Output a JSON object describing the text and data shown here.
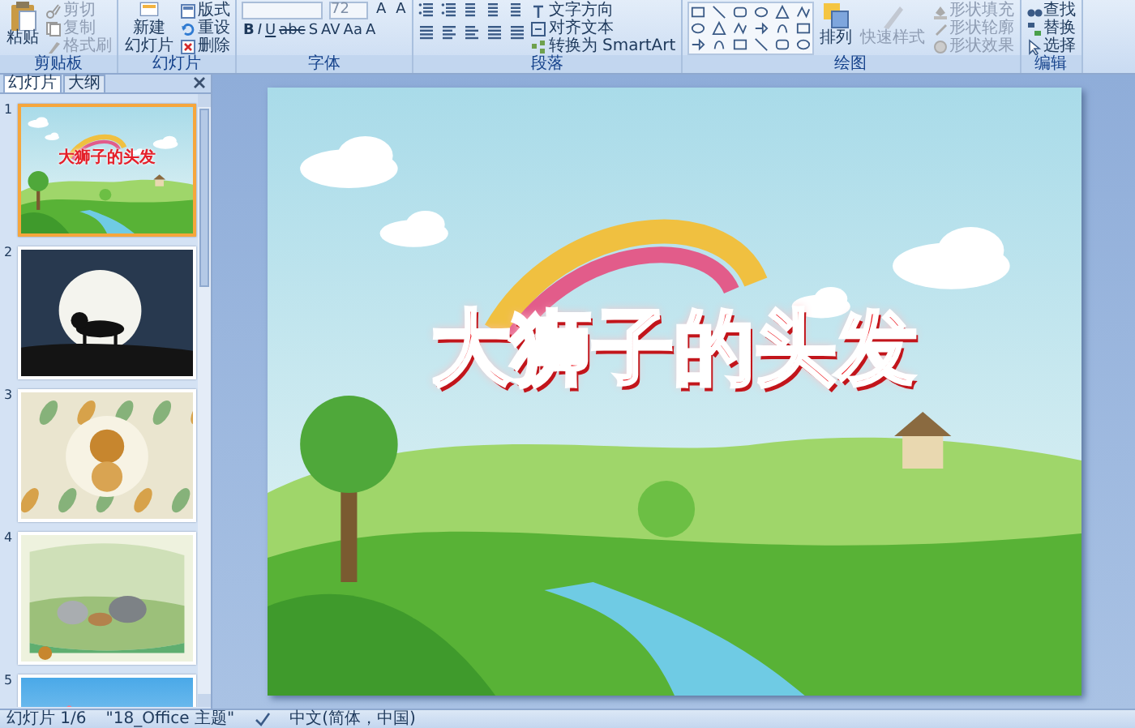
{
  "ribbon": {
    "groups": [
      {
        "label": "剪贴板",
        "items": [
          {
            "kind": "large",
            "lines": [
              "粘贴"
            ],
            "disabled": false
          },
          {
            "kind": "small",
            "label": "剪切",
            "disabled": true
          },
          {
            "kind": "small",
            "label": "复制",
            "disabled": true
          },
          {
            "kind": "small",
            "label": "格式刷",
            "disabled": true
          }
        ]
      },
      {
        "label": "幻灯片",
        "items": [
          {
            "kind": "large",
            "lines": [
              "新建",
              "幻灯片"
            ],
            "disabled": false
          },
          {
            "kind": "small",
            "label": "版式",
            "disabled": false
          },
          {
            "kind": "small",
            "label": "重设",
            "disabled": false
          },
          {
            "kind": "small",
            "label": "删除",
            "disabled": false
          }
        ]
      },
      {
        "label": "字体",
        "items": [
          {
            "kind": "fontbox",
            "size": "72",
            "row1": [
              "A",
              "A"
            ],
            "row2": [
              "B",
              "I",
              "U",
              "abc",
              "S",
              "AV",
              "Aa",
              "A"
            ]
          }
        ]
      },
      {
        "label": "段落",
        "items": [
          {
            "kind": "paragraph"
          },
          {
            "kind": "small",
            "label": "文字方向",
            "disabled": false
          },
          {
            "kind": "small",
            "label": "对齐文本",
            "disabled": false
          },
          {
            "kind": "small",
            "label": "转换为 SmartArt",
            "disabled": false
          }
        ]
      },
      {
        "label": "绘图",
        "items": [
          {
            "kind": "gallery"
          },
          {
            "kind": "large",
            "lines": [
              "排列"
            ],
            "disabled": false
          },
          {
            "kind": "large",
            "lines": [
              "快速样式"
            ],
            "disabled": true
          },
          {
            "kind": "small",
            "label": "形状填充",
            "disabled": true
          },
          {
            "kind": "small",
            "label": "形状轮廓",
            "disabled": true
          },
          {
            "kind": "small",
            "label": "形状效果",
            "disabled": true
          }
        ]
      },
      {
        "label": "编辑",
        "items": [
          {
            "kind": "small",
            "label": "查找",
            "disabled": false
          },
          {
            "kind": "small",
            "label": "替换",
            "disabled": false
          },
          {
            "kind": "small",
            "label": "选择",
            "disabled": false
          }
        ]
      }
    ]
  },
  "pane": {
    "tabs": [
      {
        "label": "幻灯片",
        "selected": true
      },
      {
        "label": "大纲",
        "selected": false
      }
    ],
    "slides": [
      {
        "number": "1",
        "selected": true,
        "title": "大狮子的头发"
      },
      {
        "number": "2",
        "selected": false
      },
      {
        "number": "3",
        "selected": false
      },
      {
        "number": "4",
        "selected": false
      },
      {
        "number": "5",
        "selected": false
      }
    ]
  },
  "slide": {
    "title": "大狮子的头发"
  },
  "status_bar": [
    "幻灯片 1/6",
    "\"18_Office 主题\"",
    "中文(简体，中国)"
  ]
}
